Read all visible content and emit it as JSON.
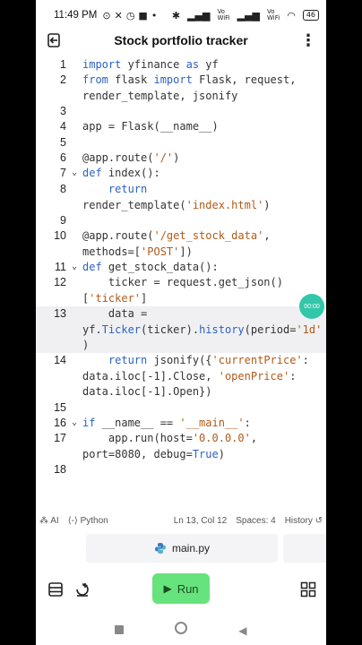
{
  "status_bar": {
    "time": "11:49 PM",
    "network_right_1": "Vo\nWiFi",
    "network_right_2": "Vo\nWiFi",
    "battery": "46"
  },
  "app_bar": {
    "title": "Stock portfolio tracker"
  },
  "editor": {
    "lines": [
      {
        "n": "1",
        "text": "import yfinance as yf"
      },
      {
        "n": "2",
        "text": "from flask import Flask, request,\nrender_template, jsonify"
      },
      {
        "n": "3",
        "text": ""
      },
      {
        "n": "4",
        "text": "app = Flask(__name__)"
      },
      {
        "n": "5",
        "text": ""
      },
      {
        "n": "6",
        "text": "@app.route('/')"
      },
      {
        "n": "7",
        "text": "def index():"
      },
      {
        "n": "8",
        "text": "    return\nrender_template('index.html')"
      },
      {
        "n": "9",
        "text": ""
      },
      {
        "n": "10",
        "text": "@app.route('/get_stock_data',\nmethods=['POST'])"
      },
      {
        "n": "11",
        "text": "def get_stock_data():"
      },
      {
        "n": "12",
        "text": "    ticker = request.get_json()\n['ticker']"
      },
      {
        "n": "13",
        "text": "    data =\nyf.Ticker(ticker).history(period='1d'\n)"
      },
      {
        "n": "14",
        "text": "    return jsonify({'currentPrice':\ndata.iloc[-1].Close, 'openPrice':\ndata.iloc[-1].Open})"
      },
      {
        "n": "15",
        "text": ""
      },
      {
        "n": "16",
        "text": "if __name__ == '__main__':"
      },
      {
        "n": "17",
        "text": "    app.run(host='0.0.0.0',\nport=8080, debug=True)"
      },
      {
        "n": "18",
        "text": ""
      }
    ],
    "timer_badge": "00:00"
  },
  "editor_status": {
    "ai_label": "AI",
    "language": "Python",
    "cursor_position": "Ln 13, Col 12",
    "indent": "Spaces: 4",
    "history": "History"
  },
  "file_tab": {
    "filename": "main.py"
  },
  "toolbar": {
    "run_label": "Run"
  },
  "colors": {
    "keyword": "#2c62c5",
    "string": "#b25a18",
    "run_button": "#67e37d",
    "timer_badge": "#32c7a8"
  }
}
